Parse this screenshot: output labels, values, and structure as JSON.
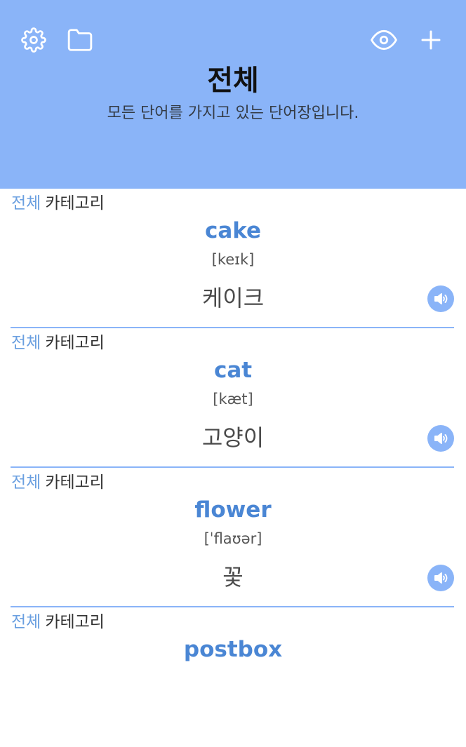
{
  "header": {
    "title": "전체",
    "subtitle": "모든 단어를 가지고 있는 단어장입니다.",
    "icons": [
      "gear-icon",
      "folder-icon",
      "eye-icon",
      "plus-icon"
    ],
    "background_color": "#8ab4f8"
  },
  "words": [
    {
      "crumb_all": "전체",
      "crumb_category": "카테고리",
      "word": "cake",
      "phonetic": "[keɪk]",
      "meaning": "케이크"
    },
    {
      "crumb_all": "전체",
      "crumb_category": "카테고리",
      "word": "cat",
      "phonetic": "[kæt]",
      "meaning": "고양이"
    },
    {
      "crumb_all": "전체",
      "crumb_category": "카테고리",
      "word": "flower",
      "phonetic": "[ˈflaʊər]",
      "meaning": "꽃"
    },
    {
      "crumb_all": "전체",
      "crumb_category": "카테고리",
      "word": "postbox",
      "phonetic": "",
      "meaning": ""
    }
  ],
  "colors": {
    "accent": "#8ab4f8",
    "word": "#4a86d4",
    "crumb_all": "#6a9fe0"
  }
}
